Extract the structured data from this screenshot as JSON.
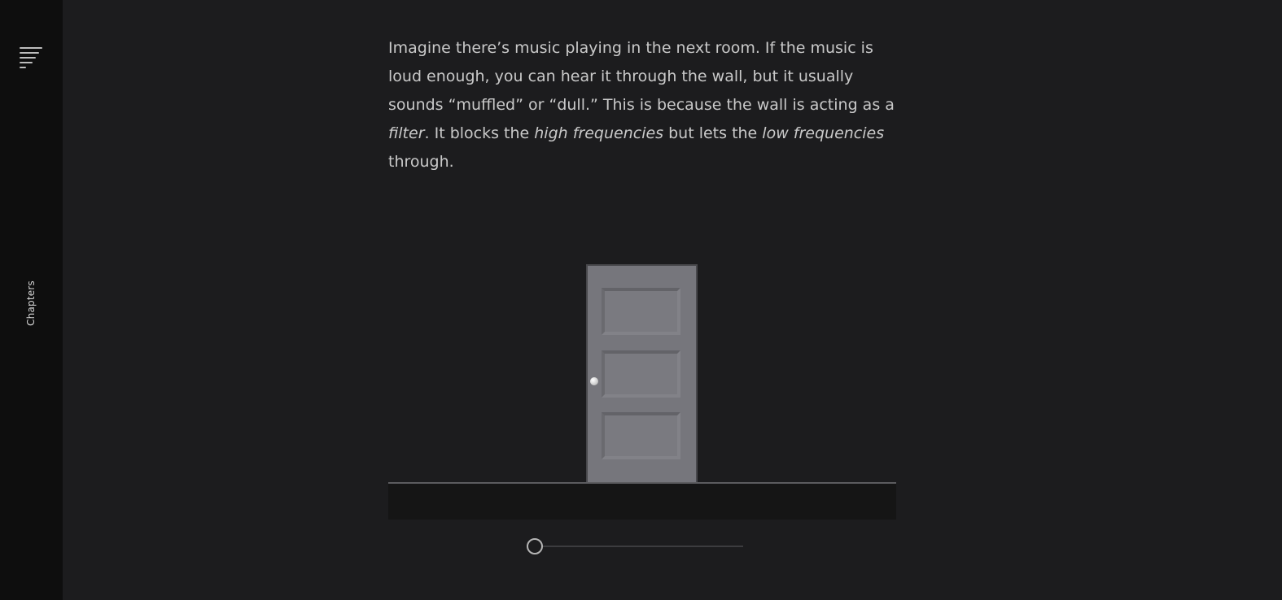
{
  "sidebar": {
    "menu_icon": "menu-lines-icon",
    "chapters_label": "Chapters"
  },
  "article": {
    "line1": "Imagine there’s music playing in the next room. If the music is loud enough, you can hear it through the wall, but it usually sounds “muffled” or “dull.” This is because the wall is acting as a ",
    "em1": "filter",
    "line2": ". It blocks the ",
    "em2": "high frequencies",
    "line3": " but lets the ",
    "em3": "low frequencies",
    "line4": " through."
  },
  "illustration": {
    "door_icon": "door-icon",
    "colors": {
      "door": "#76767c",
      "floor": "#151515"
    }
  },
  "slider": {
    "value": 0,
    "min": 0,
    "max": 1
  },
  "colors": {
    "background": "#1c1c1e",
    "sidebar": "#0e0e0e",
    "text": "#c9c9c9"
  }
}
